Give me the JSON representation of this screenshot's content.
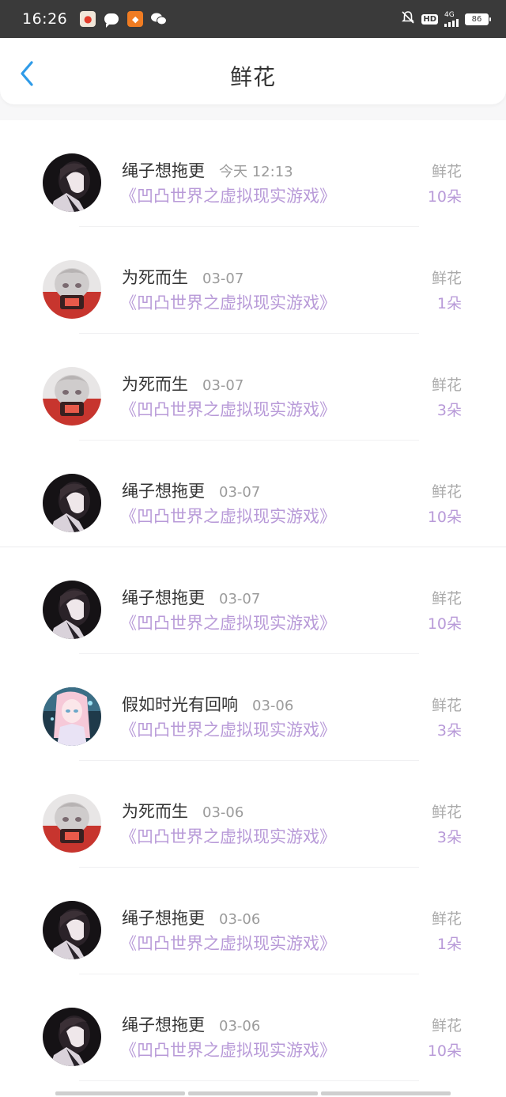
{
  "status_bar": {
    "time": "16:26",
    "network": "4G",
    "hd": "HD",
    "battery": "86"
  },
  "header": {
    "title": "鲜花"
  },
  "gifts": [
    {
      "user": "绳子想拖更",
      "time": "今天 12:13",
      "book": "《凹凸世界之虚拟现实游戏》",
      "gift_label": "鲜花",
      "count": "10朵",
      "avatar": "dark"
    },
    {
      "user": "为死而生",
      "time": "03-07",
      "book": "《凹凸世界之虚拟现实游戏》",
      "gift_label": "鲜花",
      "count": "1朵",
      "avatar": "light"
    },
    {
      "user": "为死而生",
      "time": "03-07",
      "book": "《凹凸世界之虚拟现实游戏》",
      "gift_label": "鲜花",
      "count": "3朵",
      "avatar": "light"
    },
    {
      "user": "绳子想拖更",
      "time": "03-07",
      "book": "《凹凸世界之虚拟现实游戏》",
      "gift_label": "鲜花",
      "count": "10朵",
      "avatar": "dark"
    },
    {
      "user": "绳子想拖更",
      "time": "03-07",
      "book": "《凹凸世界之虚拟现实游戏》",
      "gift_label": "鲜花",
      "count": "10朵",
      "avatar": "dark"
    },
    {
      "user": "假如时光有回响",
      "time": "03-06",
      "book": "《凹凸世界之虚拟现实游戏》",
      "gift_label": "鲜花",
      "count": "3朵",
      "avatar": "pastel"
    },
    {
      "user": "为死而生",
      "time": "03-06",
      "book": "《凹凸世界之虚拟现实游戏》",
      "gift_label": "鲜花",
      "count": "3朵",
      "avatar": "light"
    },
    {
      "user": "绳子想拖更",
      "time": "03-06",
      "book": "《凹凸世界之虚拟现实游戏》",
      "gift_label": "鲜花",
      "count": "1朵",
      "avatar": "dark"
    },
    {
      "user": "绳子想拖更",
      "time": "03-06",
      "book": "《凹凸世界之虚拟现实游戏》",
      "gift_label": "鲜花",
      "count": "10朵",
      "avatar": "dark"
    }
  ],
  "colors": {
    "accent_purple": "#b89ad8",
    "back_blue": "#2f9be8"
  }
}
